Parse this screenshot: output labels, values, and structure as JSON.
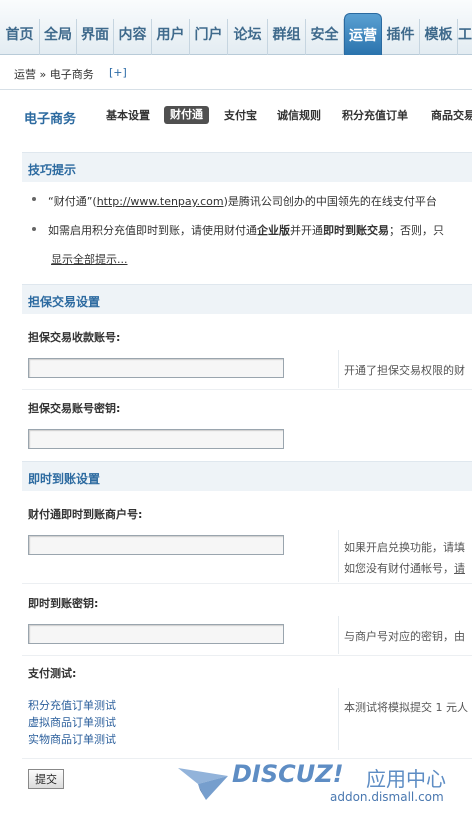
{
  "topnav": {
    "tabs": [
      {
        "label": "首页",
        "active": false
      },
      {
        "label": "全局",
        "active": false
      },
      {
        "label": "界面",
        "active": false
      },
      {
        "label": "内容",
        "active": false
      },
      {
        "label": "用户",
        "active": false
      },
      {
        "label": "门户",
        "active": false
      },
      {
        "label": "论坛",
        "active": false
      },
      {
        "label": "群组",
        "active": false
      },
      {
        "label": "安全",
        "active": false
      },
      {
        "label": "运营",
        "active": true
      },
      {
        "label": "插件",
        "active": false
      },
      {
        "label": "模板",
        "active": false
      },
      {
        "label": "工",
        "active": false
      }
    ]
  },
  "breadcrumb": {
    "text": "运营 » 电子商务",
    "add": "[+]"
  },
  "subnav": {
    "title": "电子商务",
    "items": [
      {
        "label": "基本设置",
        "active": false
      },
      {
        "label": "财付通",
        "active": true
      },
      {
        "label": "支付宝",
        "active": false
      },
      {
        "label": "诚信规则",
        "active": false
      },
      {
        "label": "积分充值订单",
        "active": false
      },
      {
        "label": "商品交易",
        "active": false
      }
    ]
  },
  "tips": {
    "header": "技巧提示",
    "tip1": {
      "prefix": "“财付通”(",
      "link": "http://www.tenpay.com",
      "suffix": ")是腾讯公司创办的中国领先的在线支付平台"
    },
    "tip2": {
      "part1": "如需启用积分充值即时到账，请使用财付通",
      "bold1": "企业版",
      "part2": "并开通",
      "bold2": "即时到账交易",
      "part3": "；否则，只"
    },
    "show_all": "显示全部提示..."
  },
  "escrow": {
    "header": "担保交易设置",
    "account_label": "担保交易收款账号:",
    "account_value": "",
    "account_hint": "开通了担保交易权限的财",
    "key_label": "担保交易账号密钥:",
    "key_value": ""
  },
  "instant": {
    "header": "即时到账设置",
    "merchant_label": "财付通即时到账商户号:",
    "merchant_value": "",
    "merchant_hint1": "如果开启兑换功能，请填",
    "merchant_hint2_pre": "如您没有财付通帐号，",
    "merchant_hint2_link": "请",
    "key_label": "即时到账密钥:",
    "key_value": "",
    "key_hint": "与商户号对应的密钥，由"
  },
  "test": {
    "label": "支付测试:",
    "links": [
      "积分充值订单测试",
      "虚拟商品订单测试",
      "实物商品订单测试"
    ],
    "hint": "本测试将模拟提交 1 元人"
  },
  "submit_label": "提交",
  "watermark": {
    "logo": "DISCUZ!",
    "cn": "应用中心",
    "url": "addon.dismall.com"
  }
}
